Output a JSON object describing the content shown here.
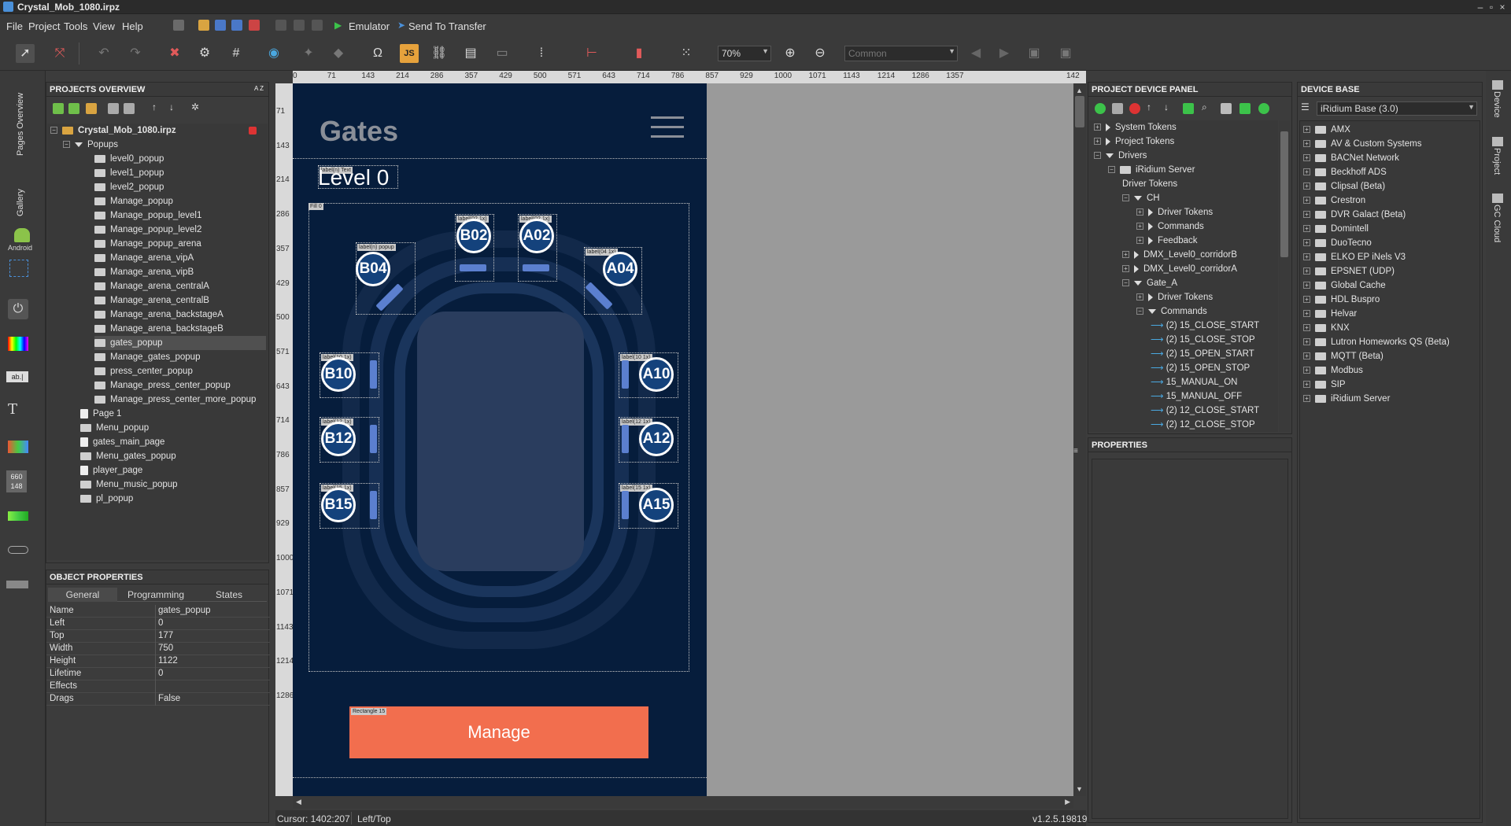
{
  "window": {
    "title": "Crystal_Mob_1080.irpz"
  },
  "menu": {
    "items": [
      "File",
      "Project",
      "Tools",
      "View",
      "Help"
    ],
    "emulator": "Emulator",
    "send": "Send To Transfer"
  },
  "toolbar": {
    "zoom": "70%",
    "style_combo": "Common"
  },
  "left_tabs": {
    "pages_overview": "Pages Overview",
    "gallery": "Gallery",
    "android": "Android",
    "num_top": "660",
    "num_bottom": "148"
  },
  "projects_overview": {
    "title": "PROJECTS OVERVIEW",
    "sort_label": "A Z",
    "root": "Crystal_Mob_1080.irpz",
    "popups_label": "Popups",
    "popups": [
      "level0_popup",
      "level1_popup",
      "level2_popup",
      "Manage_popup",
      "Manage_popup_level1",
      "Manage_popup_level2",
      "Manage_popup_arena",
      "Manage_arena_vipA",
      "Manage_arena_vipB",
      "Manage_arena_centralA",
      "Manage_arena_centralB",
      "Manage_arena_backstageA",
      "Manage_arena_backstageB",
      "gates_popup",
      "Manage_gates_popup",
      "press_center_popup",
      "Manage_press_center_popup",
      "Manage_press_center_more_popup"
    ],
    "pages": [
      {
        "name": "Page 1",
        "kind": "page"
      },
      {
        "name": "Menu_popup",
        "kind": "popup"
      },
      {
        "name": "gates_main_page",
        "kind": "page"
      },
      {
        "name": "Menu_gates_popup",
        "kind": "popup"
      },
      {
        "name": "player_page",
        "kind": "page"
      },
      {
        "name": "Menu_music_popup",
        "kind": "popup"
      },
      {
        "name": "pl_popup",
        "kind": "popup"
      }
    ]
  },
  "object_properties": {
    "title": "OBJECT PROPERTIES",
    "tabs": [
      "General",
      "Programming",
      "States"
    ],
    "rows": [
      {
        "k": "Name",
        "v": "gates_popup"
      },
      {
        "k": "Left",
        "v": "0"
      },
      {
        "k": "Top",
        "v": "177"
      },
      {
        "k": "Width",
        "v": "750"
      },
      {
        "k": "Height",
        "v": "1122"
      },
      {
        "k": "Lifetime",
        "v": "0"
      },
      {
        "k": "Effects",
        "v": ""
      },
      {
        "k": "Drags",
        "v": "False"
      }
    ]
  },
  "ruler_top": [
    "0",
    "71",
    "143",
    "214",
    "286",
    "357",
    "429",
    "500",
    "571",
    "643",
    "714",
    "786",
    "857",
    "929",
    "1000",
    "1071",
    "1143",
    "1214",
    "1286",
    "1357",
    "142"
  ],
  "ruler_left": [
    "71",
    "143",
    "214",
    "286",
    "357",
    "429",
    "500",
    "571",
    "643",
    "714",
    "786",
    "857",
    "929",
    "1000",
    "1071",
    "1143",
    "1214",
    "1286"
  ],
  "design": {
    "header": "Gates",
    "level": "Level 0",
    "gates": {
      "b04": "B04",
      "b02": "B02",
      "a02": "A02",
      "a04": "A04",
      "b10": "B10",
      "a10": "A10",
      "b12": "B12",
      "a12": "A12",
      "b15": "B15",
      "a15": "A15"
    },
    "manage_button": "Manage",
    "tags": {
      "level": "label(n) Text",
      "area": "Fill 0",
      "b04a": "label(n) popup",
      "b04b": "label(04 1x)",
      "b02": "label(02 1x)",
      "a02": "label(02 1x)",
      "a04a": "label(n)",
      "a04b": "label(04 1x)",
      "b10": "label(10 1x)",
      "a10a": "label(n)",
      "a10b": "label(10 1x)",
      "b12": "label(12 1x)",
      "a12": "label(12 1x)",
      "b15": "label(15 1x)",
      "a15": "label(15 1x)",
      "manage": "Rectangle 15"
    },
    "colors": {
      "bg": "#061d3c",
      "gate": "#14427c",
      "bar": "#5b7fcf",
      "button": "#f26e4e"
    }
  },
  "status": {
    "cursor": "Cursor: 1402:207",
    "anchor": "Left/Top",
    "version": "v1.2.5.19819"
  },
  "device_panel": {
    "title": "PROJECT DEVICE PANEL",
    "rows": [
      {
        "t": "System Tokens",
        "lvl": 0,
        "exp": "right"
      },
      {
        "t": "Project Tokens",
        "lvl": 0,
        "exp": "right"
      },
      {
        "t": "Drivers",
        "lvl": 0,
        "exp": "down"
      },
      {
        "t": "iRidium Server",
        "lvl": 1,
        "exp": "pm"
      },
      {
        "t": "Driver Tokens",
        "lvl": 2,
        "exp": "none"
      },
      {
        "t": "CH",
        "lvl": 2,
        "exp": "down"
      },
      {
        "t": "Driver Tokens",
        "lvl": 3,
        "exp": "right"
      },
      {
        "t": "Commands",
        "lvl": 3,
        "exp": "right"
      },
      {
        "t": "Feedback",
        "lvl": 3,
        "exp": "right"
      },
      {
        "t": "DMX_Level0_corridorB",
        "lvl": 2,
        "exp": "right"
      },
      {
        "t": "DMX_Level0_corridorA",
        "lvl": 2,
        "exp": "right"
      },
      {
        "t": "Gate_A",
        "lvl": 2,
        "exp": "down"
      },
      {
        "t": "Driver Tokens",
        "lvl": 3,
        "exp": "right"
      },
      {
        "t": "Commands",
        "lvl": 3,
        "exp": "down"
      },
      {
        "t": "(2) 15_CLOSE_START",
        "lvl": 4,
        "exp": "cmd"
      },
      {
        "t": "(2) 15_CLOSE_STOP",
        "lvl": 4,
        "exp": "cmd"
      },
      {
        "t": "(2) 15_OPEN_START",
        "lvl": 4,
        "exp": "cmd"
      },
      {
        "t": "(2) 15_OPEN_STOP",
        "lvl": 4,
        "exp": "cmd"
      },
      {
        "t": "15_MANUAL_ON",
        "lvl": 4,
        "exp": "cmd"
      },
      {
        "t": "15_MANUAL_OFF",
        "lvl": 4,
        "exp": "cmd"
      },
      {
        "t": "(2) 12_CLOSE_START",
        "lvl": 4,
        "exp": "cmd"
      },
      {
        "t": "(2) 12_CLOSE_STOP",
        "lvl": 4,
        "exp": "cmd"
      }
    ],
    "properties_title": "PROPERTIES"
  },
  "device_base": {
    "title": "DEVICE BASE",
    "selector": "iRidium Base (3.0)",
    "items": [
      "AMX",
      "AV & Custom Systems",
      "BACNet Network",
      "Beckhoff ADS",
      "Clipsal (Beta)",
      "Crestron",
      "DVR Galact (Beta)",
      "Domintell",
      "DuoTecno",
      "ELKO EP iNels V3",
      "EPSNET (UDP)",
      "Global Cache",
      "HDL Buspro",
      "Helvar",
      "KNX",
      "Lutron Homeworks QS (Beta)",
      "MQTT (Beta)",
      "Modbus",
      "SIP",
      "iRidium Server"
    ]
  },
  "right_tabs": [
    "Device",
    "Project",
    "GC Cloud"
  ]
}
